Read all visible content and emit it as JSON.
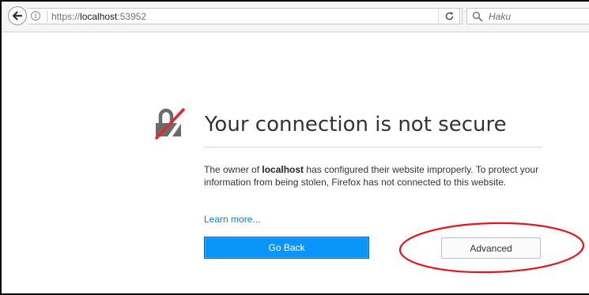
{
  "browser": {
    "url_scheme": "https://",
    "url_host": "localhost",
    "url_port": ":53952",
    "search_text": "Haku",
    "info_glyph": "i",
    "icons": {
      "back": "back-arrow-icon",
      "info": "info-icon",
      "reload": "reload-icon",
      "search": "search-magnifier-icon"
    }
  },
  "error_page": {
    "title": "Your connection is not secure",
    "description_prefix": "The owner of ",
    "description_host": "localhost",
    "description_suffix": " has configured their website improperly. To protect your information from being stolen, Firefox has not connected to this website.",
    "learn_more": "Learn more...",
    "go_back_label": "Go Back",
    "advanced_label": "Advanced",
    "icon": "broken-lock-icon"
  },
  "colors": {
    "primary_button": "#0996f8",
    "link": "#0a84c8",
    "annotation": "#e8141c",
    "lock_gray": "#6b6b6b",
    "lock_slash": "#e12b2b"
  },
  "annotation": {
    "shape": "ellipse",
    "target": "advanced-button"
  }
}
